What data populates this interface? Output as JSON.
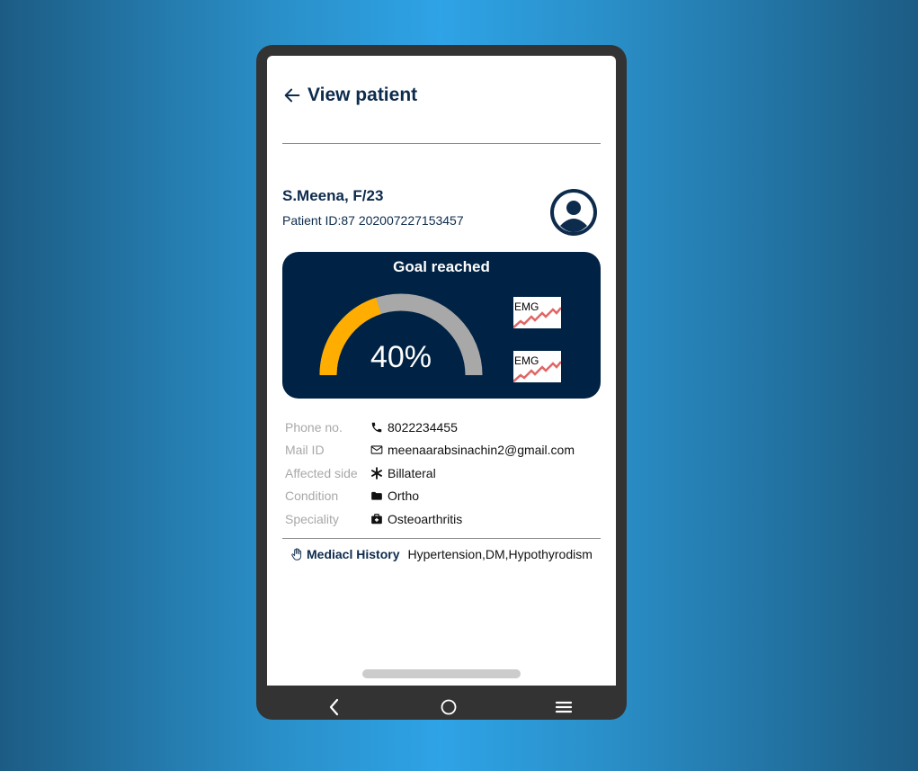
{
  "header": {
    "title": "View patient",
    "back_icon": "arrow-left-icon"
  },
  "patient": {
    "name": "S.Meena, F/23",
    "id_line": "Patient ID:87 202007227153457",
    "avatar_icon": "user-avatar-icon"
  },
  "goal": {
    "title": "Goal reached",
    "percent_text": "40%",
    "progress_fraction": 0.4,
    "colors": {
      "fill": "#ffad00",
      "track": "#a8a8a8",
      "card": "#002244"
    },
    "thumbnails": [
      {
        "label": "EMG"
      },
      {
        "label": "EMG"
      }
    ]
  },
  "details": [
    {
      "label": "Phone no.",
      "icon": "phone-icon",
      "value": "8022234455"
    },
    {
      "label": "Mail ID",
      "icon": "mail-icon",
      "value": "meenaarabsinachin2@gmail.com"
    },
    {
      "label": "Affected side",
      "icon": "asterisk-icon",
      "value": "Billateral"
    },
    {
      "label": "Condition",
      "icon": "folder-icon",
      "value": "Ortho"
    },
    {
      "label": "Speciality",
      "icon": "medical-kit-icon",
      "value": "Osteoarthritis"
    }
  ],
  "history": {
    "label": "Mediacl History",
    "value": "Hypertension,DM,Hypothyrodism",
    "icon": "hand-icon"
  },
  "navbar": {
    "icons": [
      "nav-back-icon",
      "nav-home-icon",
      "nav-menu-icon"
    ]
  }
}
